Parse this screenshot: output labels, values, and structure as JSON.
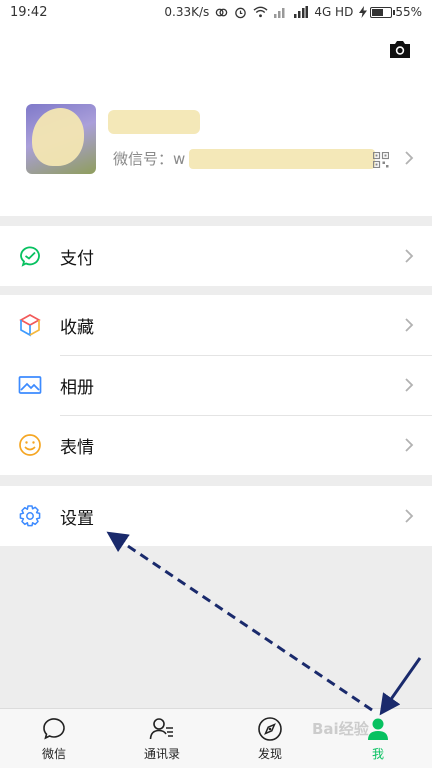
{
  "status_bar": {
    "time": "19:42",
    "net_speed": "0.33K/s",
    "network": "4G HD",
    "battery": "55%",
    "battery_level": 0.55
  },
  "profile": {
    "wechat_id_label": "微信号：w"
  },
  "menu": {
    "pay": "支付",
    "favorites": "收藏",
    "album": "相册",
    "stickers": "表情",
    "settings": "设置"
  },
  "tabs": [
    {
      "label": "微信"
    },
    {
      "label": "通讯录"
    },
    {
      "label": "发现"
    },
    {
      "label": "我"
    }
  ],
  "watermark": "Bai经验",
  "colors": {
    "accent": "#07c160",
    "annotation": "#1a2a6c"
  }
}
